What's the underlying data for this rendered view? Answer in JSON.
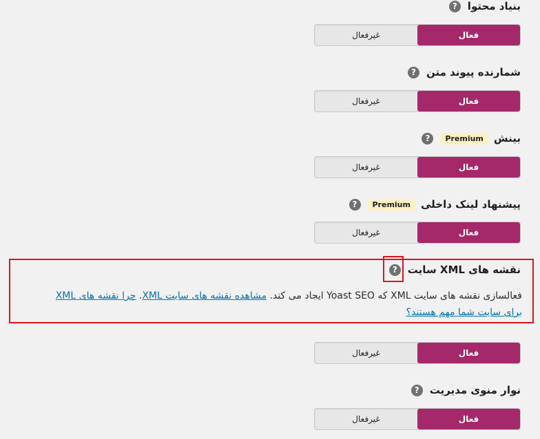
{
  "toggle_labels": {
    "on": "فعال",
    "off": "غیرفعال"
  },
  "help_symbol": "?",
  "sections": [
    {
      "title": "بنیاد محتوا"
    },
    {
      "title": "شمارنده پیوند متن"
    },
    {
      "title": "بینش",
      "badge": "Premium"
    },
    {
      "title": "پیشنهاد لینک داخلی",
      "badge": "Premium"
    },
    {
      "title": "نقشه های XML سایت"
    },
    {
      "title": "نوار منوی مدیریت"
    }
  ],
  "xml_description": {
    "text": "فعالسازی نقشه های سایت XML که Yoast SEO ایجاد می کند.",
    "link1": "مشاهده نقشه های سایت XML",
    "link2": "چرا نقشه های XML برای سایت شما مهم هستند؟"
  },
  "colors": {
    "active": "#a4286a",
    "highlight": "#e0121b",
    "link": "#0073aa"
  }
}
